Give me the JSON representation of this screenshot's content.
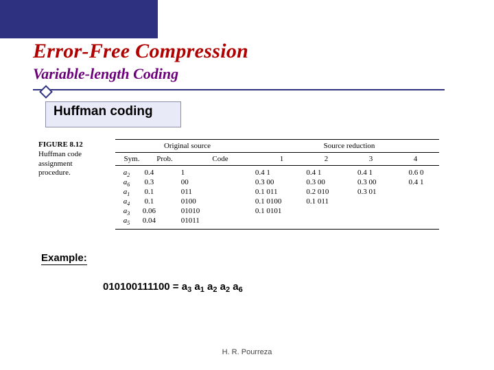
{
  "title": "Error-Free Compression",
  "subtitle": "Variable-length Coding",
  "section": "Huffman coding",
  "figure": {
    "caption_bold": "FIGURE 8.12",
    "caption_rest": "Huffman code assignment procedure."
  },
  "table": {
    "header1": {
      "original": "Original source",
      "reduction": "Source reduction"
    },
    "header2": {
      "sym": "Sym.",
      "prob": "Prob.",
      "code": "Code",
      "c1": "1",
      "c2": "2",
      "c3": "3",
      "c4": "4"
    },
    "rows": [
      {
        "sym": "a",
        "sub": "2",
        "prob": "0.4",
        "code": "1",
        "r1": "0.4  1",
        "r2": "0.4  1",
        "r3": "0.4   1",
        "r4": "0.6  0"
      },
      {
        "sym": "a",
        "sub": "6",
        "prob": "0.3",
        "code": "00",
        "r1": "0.3  00",
        "r2": "0.3  00",
        "r3": "0.3   00",
        "r4": "0.4  1"
      },
      {
        "sym": "a",
        "sub": "1",
        "prob": "0.1",
        "code": "011",
        "r1": "0.1  011",
        "r2": "0.2  010",
        "r3": "0.3   01",
        "r4": ""
      },
      {
        "sym": "a",
        "sub": "4",
        "prob": "0.1",
        "code": "0100",
        "r1": "0.1  0100",
        "r2": "0.1  011",
        "r3": "",
        "r4": ""
      },
      {
        "sym": "a",
        "sub": "3",
        "prob": "0.06",
        "code": "01010",
        "r1": "0.1  0101",
        "r2": "",
        "r3": "",
        "r4": ""
      },
      {
        "sym": "a",
        "sub": "5",
        "prob": "0.04",
        "code": "01011",
        "r1": "",
        "r2": "",
        "r3": "",
        "r4": ""
      }
    ]
  },
  "example_label": "Example:",
  "decode": {
    "bits": "010100111100",
    "eq": " = ",
    "terms": [
      [
        "a",
        "3"
      ],
      [
        "a",
        "1"
      ],
      [
        "a",
        "2"
      ],
      [
        "a",
        "2"
      ],
      [
        "a",
        "6"
      ]
    ]
  },
  "footer": "H. R. Pourreza"
}
